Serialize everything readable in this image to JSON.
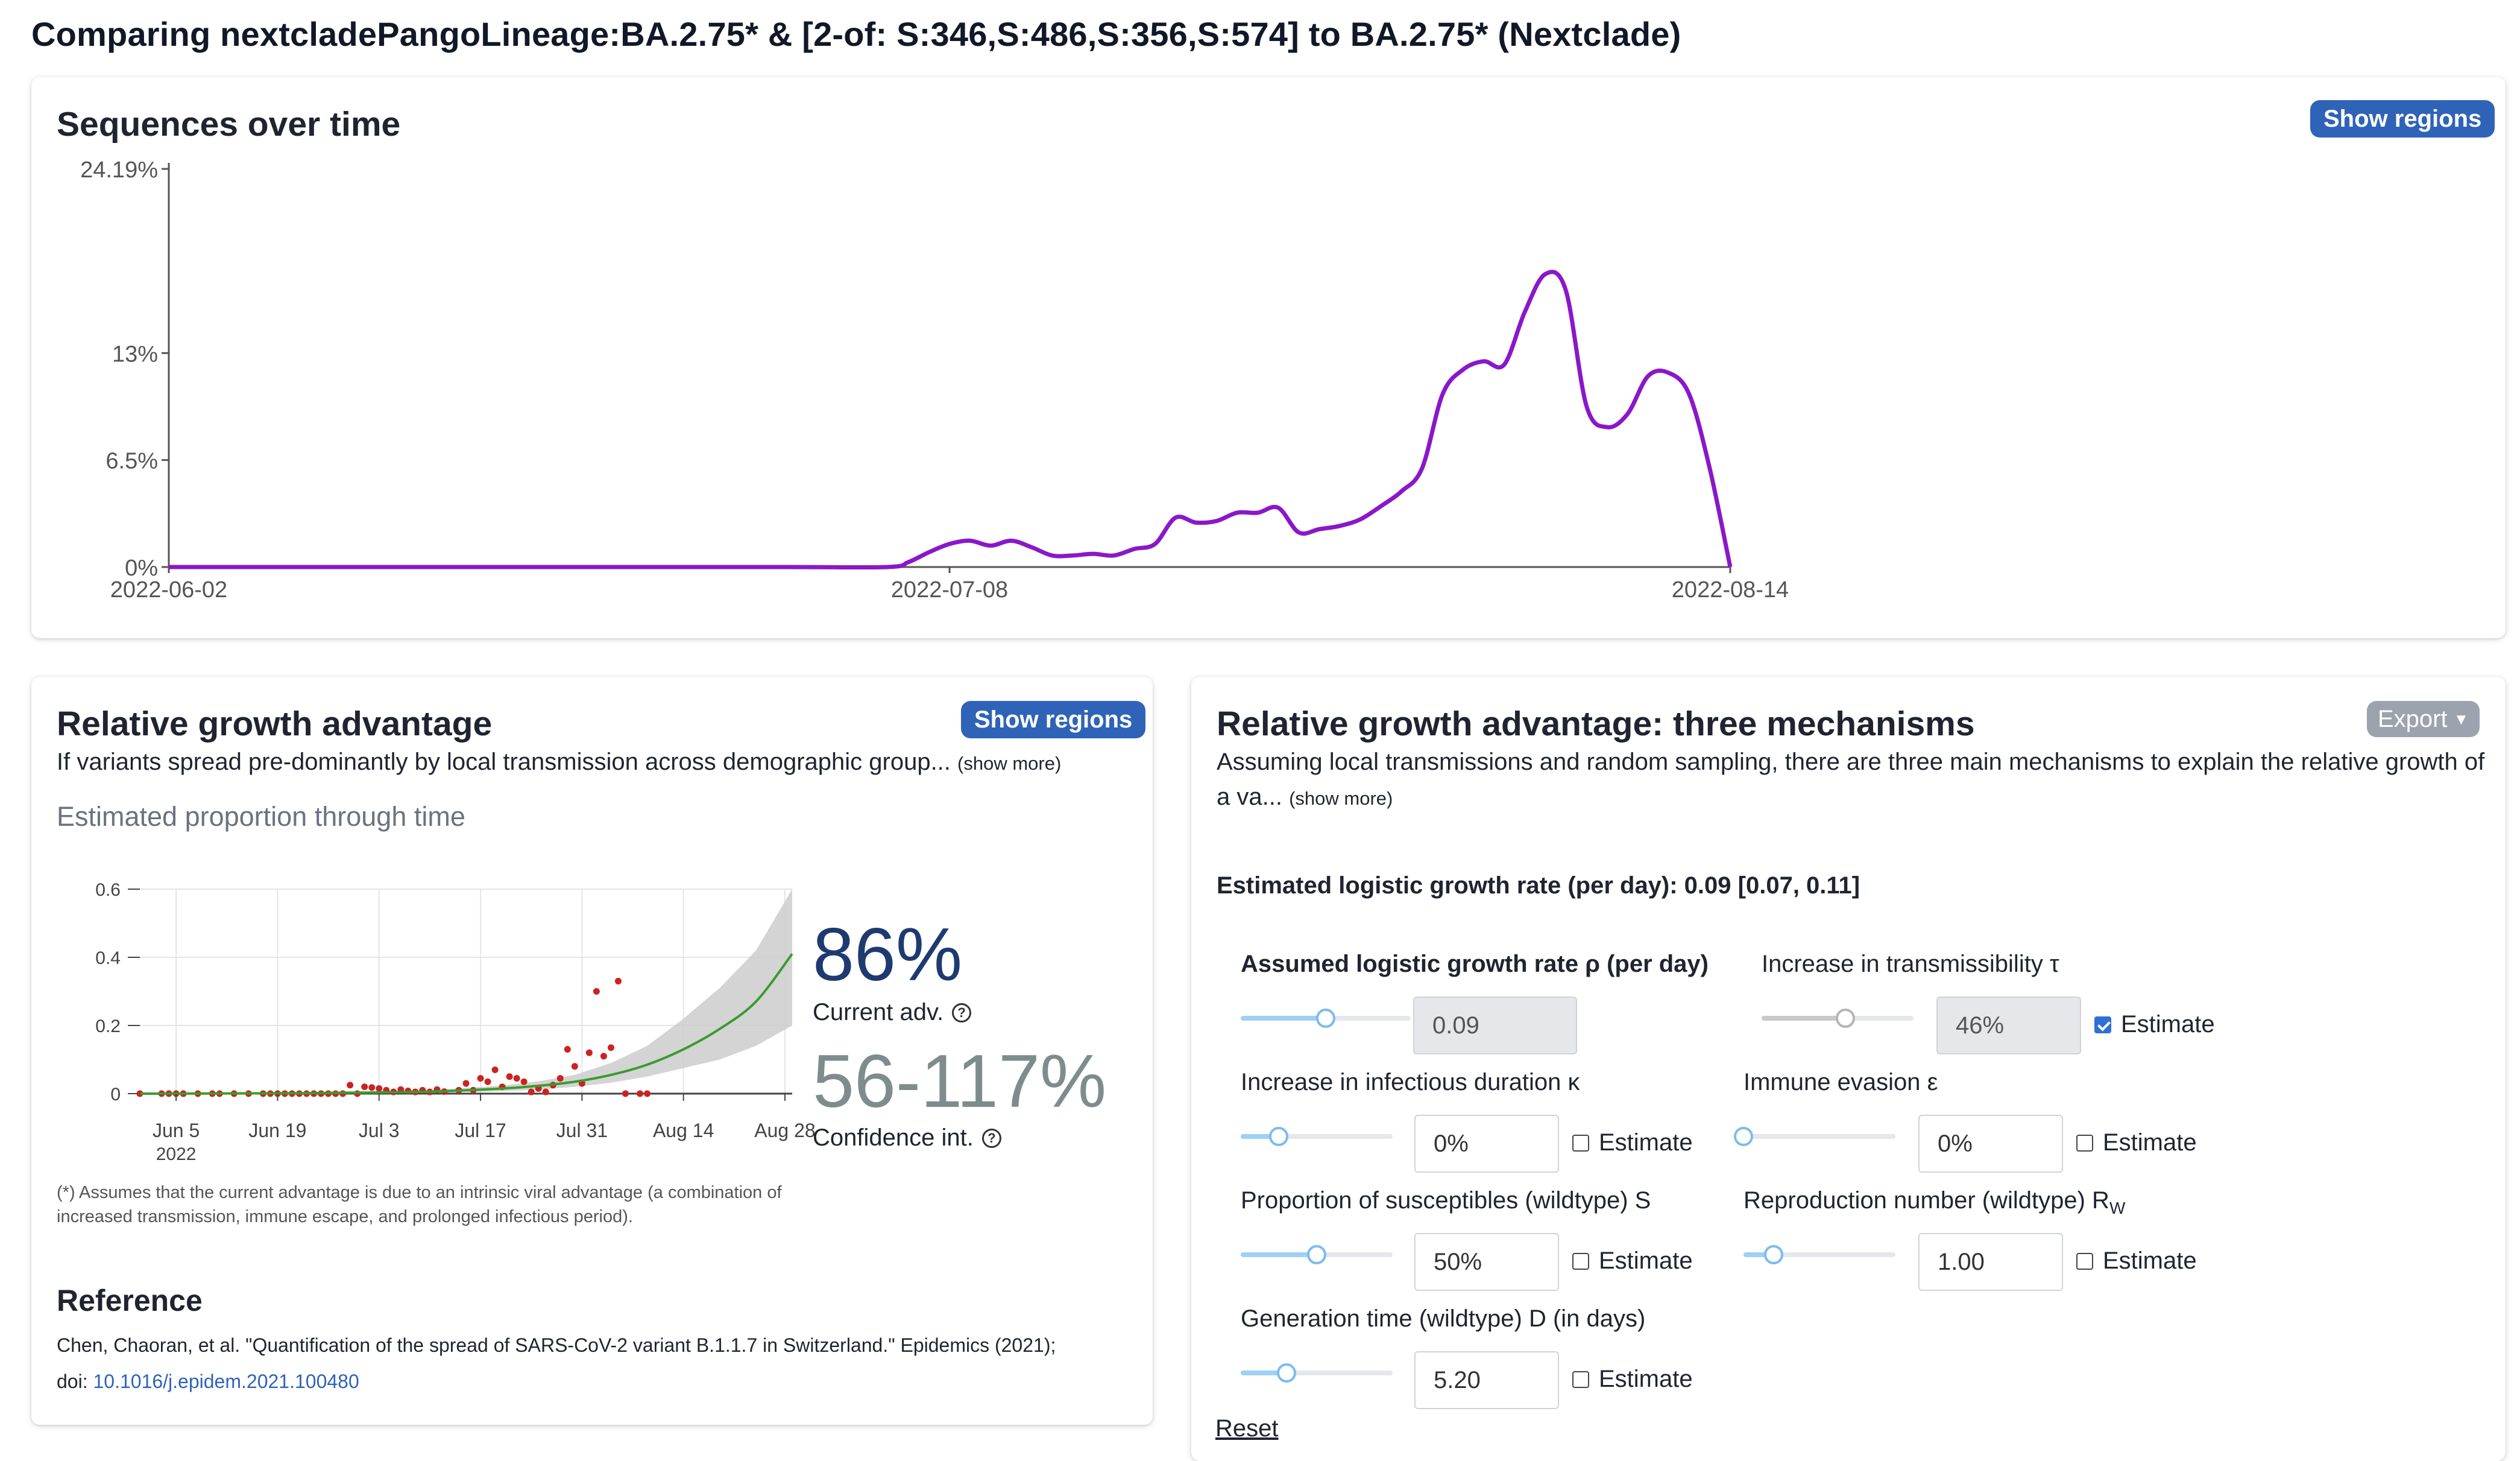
{
  "page": {
    "title": "Comparing nextcladePangoLineage:BA.2.75* & [2-of: S:346,S:486,S:356,S:574] to BA.2.75* (Nextclade)"
  },
  "sequences_card": {
    "title": "Sequences over time",
    "show_regions_label": "Show regions"
  },
  "growth_card": {
    "title": "Relative growth advantage",
    "show_regions_label": "Show regions",
    "description": "If variants spread pre-dominantly by local transmission across demographic group...",
    "show_more_label": "(show more)",
    "chart_title": "Estimated proportion through time",
    "current_adv_value": "86%",
    "current_adv_label": "Current adv.",
    "ci_value": "56-117%",
    "ci_label": "Confidence int.",
    "footnote": "(*) Assumes that the current advantage is due to an intrinsic viral advantage (a combination of increased transmission, immune escape, and prolonged infectious period).",
    "reference_title": "Reference",
    "reference_text": "Chen, Chaoran, et al. \"Quantification of the spread of SARS-CoV-2 variant B.1.1.7 in Switzerland.\" Epidemics (2021);",
    "doi_prefix": "doi:",
    "doi_link": "10.1016/j.epidem.2021.100480"
  },
  "mechanisms_card": {
    "title": "Relative growth advantage: three mechanisms",
    "export_label": "Export",
    "description": "Assuming local transmissions and random sampling, there are three main mechanisms to explain the relative growth of a va...",
    "show_more_label": "(show more)",
    "estimated_rate": "Estimated logistic growth rate (per day): 0.09 [0.07, 0.11]",
    "params": {
      "rho": {
        "label": "Assumed logistic growth rate ρ (per day)",
        "value": "0.09",
        "slider": 0.5
      },
      "tau": {
        "label": "Increase in transmissibility τ",
        "value": "46%",
        "estimate_checked": true,
        "slider": 0.55
      },
      "kappa": {
        "label": "Increase in infectious duration κ",
        "value": "0%",
        "estimate_checked": false,
        "slider": 0.25
      },
      "epsilon": {
        "label": "Immune evasion ε",
        "value": "0%",
        "estimate_checked": false,
        "slider": 0.0
      },
      "s": {
        "label": "Proportion of susceptibles (wildtype) S",
        "value": "50%",
        "estimate_checked": false,
        "slider": 0.5
      },
      "rw": {
        "label": "Reproduction number (wildtype) R",
        "label_sub": "W",
        "value": "1.00",
        "estimate_checked": false,
        "slider": 0.2
      },
      "d": {
        "label": "Generation time (wildtype) D (in days)",
        "value": "5.20",
        "estimate_checked": false,
        "slider": 0.3
      }
    },
    "estimate_label": "Estimate",
    "reset_label": "Reset"
  },
  "chart_data": [
    {
      "type": "line",
      "title": "Sequences over time",
      "x_ticks": [
        "2022-06-02",
        "2022-07-08",
        "2022-08-14"
      ],
      "y_ticks": [
        "0%",
        "6.5%",
        "13%",
        "24.19%"
      ],
      "ylim": [
        0,
        24.19
      ],
      "x": [
        0,
        10,
        20,
        30,
        35,
        36,
        37,
        38,
        39,
        40,
        41,
        42,
        43,
        44,
        45,
        46,
        47,
        48,
        49,
        50,
        51,
        52,
        53,
        54,
        55,
        56,
        57,
        58,
        59,
        60,
        61,
        62,
        63,
        64,
        65,
        66,
        67,
        68,
        69,
        70,
        71,
        72,
        73,
        74,
        75,
        76
      ],
      "values": [
        0,
        0,
        0,
        0,
        0,
        0.3,
        0.9,
        1.4,
        1.6,
        1.3,
        1.6,
        1.2,
        0.7,
        0.7,
        0.8,
        0.7,
        1.1,
        1.4,
        3.0,
        2.7,
        2.8,
        3.3,
        3.3,
        3.6,
        2.1,
        2.3,
        2.5,
        2.9,
        3.7,
        4.6,
        6.0,
        10.5,
        12.0,
        12.5,
        12.3,
        15.5,
        17.8,
        16.8,
        9.8,
        8.5,
        9.3,
        11.6,
        11.8,
        10.5,
        6.0,
        0
      ],
      "color": "#8a17c9"
    },
    {
      "type": "line",
      "title": "Estimated proportion through time",
      "x_ticks": [
        "Jun 5",
        "Jun 19",
        "Jul 3",
        "Jul 17",
        "Jul 31",
        "Aug 14",
        "Aug 28"
      ],
      "x_tick_sublabel": "2022",
      "y_ticks": [
        0,
        0.2,
        0.4,
        0.6
      ],
      "ylim": [
        0,
        0.6
      ],
      "xlim": [
        0,
        90
      ],
      "fit_x": [
        0,
        10,
        20,
        30,
        40,
        50,
        55,
        60,
        65,
        70,
        75,
        80,
        85,
        90
      ],
      "fit": [
        0,
        0.0005,
        0.001,
        0.003,
        0.006,
        0.015,
        0.023,
        0.035,
        0.055,
        0.085,
        0.13,
        0.19,
        0.27,
        0.41
      ],
      "ci_upper": [
        0,
        0.001,
        0.002,
        0.005,
        0.01,
        0.024,
        0.036,
        0.055,
        0.09,
        0.14,
        0.22,
        0.31,
        0.42,
        0.6
      ],
      "ci_lower": [
        0,
        0.0002,
        0.0005,
        0.001,
        0.002,
        0.007,
        0.012,
        0.02,
        0.032,
        0.05,
        0.075,
        0.1,
        0.14,
        0.2
      ],
      "points": [
        [
          0,
          0
        ],
        [
          3,
          0
        ],
        [
          4,
          0
        ],
        [
          5,
          0
        ],
        [
          6,
          0
        ],
        [
          8,
          0
        ],
        [
          10,
          0
        ],
        [
          11,
          0
        ],
        [
          13,
          0
        ],
        [
          15,
          0
        ],
        [
          17,
          0
        ],
        [
          18,
          0
        ],
        [
          19,
          0
        ],
        [
          20,
          0
        ],
        [
          21,
          0
        ],
        [
          22,
          0
        ],
        [
          23,
          0
        ],
        [
          24,
          0
        ],
        [
          25,
          0
        ],
        [
          26,
          0
        ],
        [
          27,
          0
        ],
        [
          28,
          0
        ],
        [
          29,
          0.025
        ],
        [
          30,
          0
        ],
        [
          31,
          0.02
        ],
        [
          32,
          0.018
        ],
        [
          33,
          0.015
        ],
        [
          34,
          0.01
        ],
        [
          35,
          0.005
        ],
        [
          36,
          0.012
        ],
        [
          37,
          0.008
        ],
        [
          38,
          0.005
        ],
        [
          39,
          0.01
        ],
        [
          40,
          0.005
        ],
        [
          41,
          0.012
        ],
        [
          42,
          0.006
        ],
        [
          44,
          0.01
        ],
        [
          45,
          0.03
        ],
        [
          46,
          0.01
        ],
        [
          47,
          0.045
        ],
        [
          48,
          0.035
        ],
        [
          49,
          0.07
        ],
        [
          50,
          0.02
        ],
        [
          51,
          0.05
        ],
        [
          52,
          0.045
        ],
        [
          53,
          0.035
        ],
        [
          54,
          0.005
        ],
        [
          55,
          0.015
        ],
        [
          56,
          0.005
        ],
        [
          57,
          0.025
        ],
        [
          58,
          0.045
        ],
        [
          59,
          0.13
        ],
        [
          60,
          0.08
        ],
        [
          61,
          0.03
        ],
        [
          62,
          0.12
        ],
        [
          63,
          0.3
        ],
        [
          64,
          0.11
        ],
        [
          65,
          0.135
        ],
        [
          66,
          0.33
        ],
        [
          67,
          0
        ],
        [
          69,
          0
        ],
        [
          70,
          0
        ]
      ],
      "fit_color": "#3a9b2e",
      "point_color": "#cc2222"
    }
  ]
}
